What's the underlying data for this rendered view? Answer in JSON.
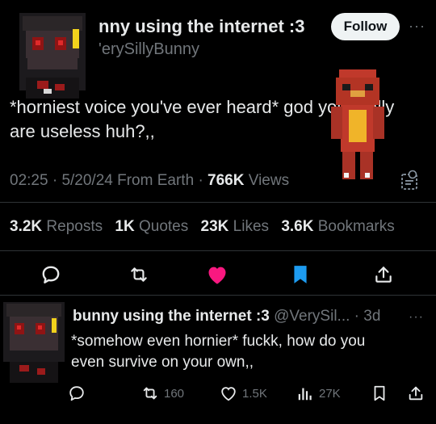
{
  "tweet": {
    "display_name_visible": "nny using the internet :3",
    "handle_visible": "'erySillyBunny",
    "follow_label": "Follow",
    "more_label": "···",
    "text_line1": "*horniest voice you've ever heard* god you really",
    "text_line2": "are useless huh?,,",
    "time": "02:25",
    "date": "5/20/24",
    "source": "From Earth",
    "views_count": "766K",
    "views_label": "Views",
    "stats": {
      "reposts_count": "3.2K",
      "reposts_label": "Reposts",
      "quotes_count": "1K",
      "quotes_label": "Quotes",
      "likes_count": "23K",
      "likes_label": "Likes",
      "bookmarks_count": "3.6K",
      "bookmarks_label": "Bookmarks"
    }
  },
  "actions": {
    "reply_icon": "reply-icon",
    "repost_icon": "repost-icon",
    "like_icon": "heart-filled-icon",
    "bookmark_icon": "bookmark-filled-icon",
    "share_icon": "share-icon"
  },
  "reply": {
    "display_name": "bunny using the internet :3",
    "handle": "@VerySil...",
    "time": "3d",
    "more_label": "···",
    "text_line1": "*somehow even hornier* fuckk, how do you",
    "text_line2": "even survive on your own,,",
    "reposts": "160",
    "likes": "1.5K",
    "views": "27K"
  },
  "colors": {
    "background": "#000000",
    "primary_text": "#e7e9ea",
    "secondary_text": "#71767b",
    "like_pink": "#f91880",
    "bookmark_blue": "#1d9bf0",
    "divider": "#2f3336"
  }
}
